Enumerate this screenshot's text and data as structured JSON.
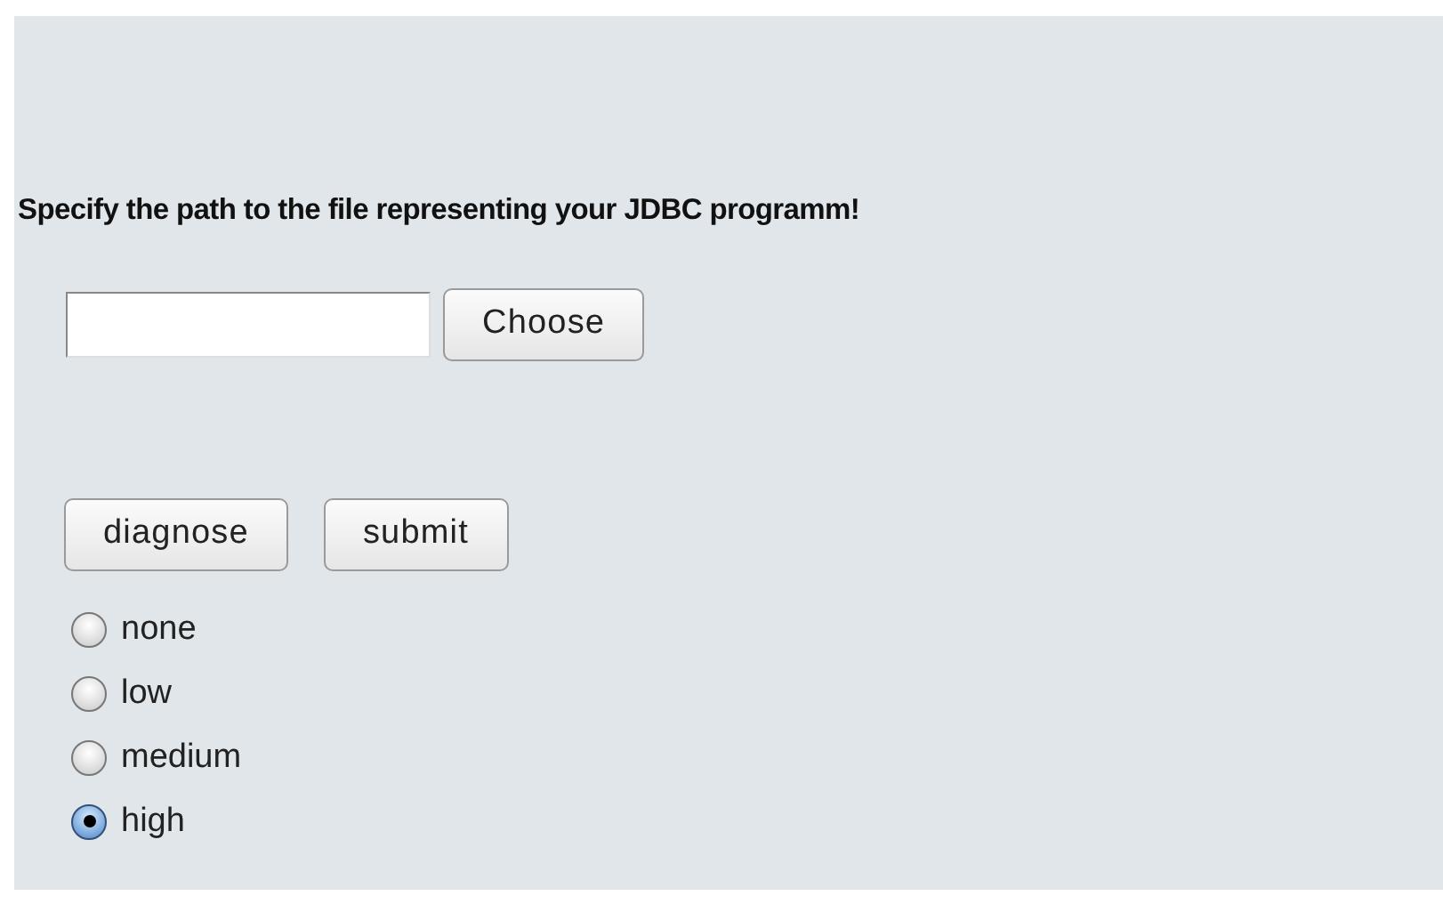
{
  "heading": "Specify the path to the file representing your JDBC programm!",
  "choose_button": "Choose",
  "actions": [
    "diagnose",
    "submit"
  ],
  "levels": [
    {
      "label": "none",
      "selected": false
    },
    {
      "label": "low",
      "selected": false
    },
    {
      "label": "medium",
      "selected": false
    },
    {
      "label": "high",
      "selected": true
    }
  ]
}
